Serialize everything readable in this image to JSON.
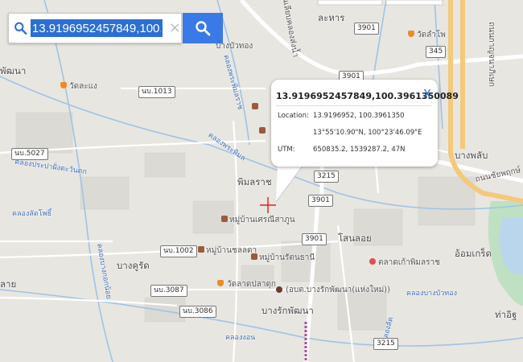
{
  "search": {
    "value": "13.9196952457849,100.3961350089",
    "clear_label": "×"
  },
  "popup": {
    "title": "13.9196952457849,100.3961350089",
    "close_label": "X",
    "location_label": "Location:",
    "location_value": "13.9196952, 100.3961350",
    "dms_value": "13°55'10.90\"N, 100°23'46.09\"E",
    "utm_label": "UTM:",
    "utm_value": "650835.2, 1539287.2, 47N"
  },
  "places": {
    "phimonrat": "พิมลราช",
    "sano_loi": "โสนลอย",
    "om_kret": "อ้อมเกร็ด",
    "bang_rak_phatthana": "บางรักพัฒนา",
    "bang_khu_rat": "บางคูรัด",
    "la_han": "ละหาร",
    "bang_bua_thong": "บางบัวทอง",
    "bang_phlap": "บางพลับ",
    "tha_it": "ท่าอิฐ",
    "bang_phai": "พัฒนา",
    "muang_edge": "ลาย",
    "khlong_lat_pho": "คลองลัดโพธิ์",
    "khlong_phraphim": "คลองพระพิมล",
    "khlong_bang_bua_thong": "คลองบางบัวทอง",
    "khlong_prapa": "คลองประปาฝั่งตะวันตก",
    "khlong_bangkok": "คลองบางกอกน้อย",
    "khlong_ngon": "คลองงอน",
    "khlong_phrong": "คลองพระพิมลราช",
    "thanon_liab": "ถนนเลียบคลองส่งน้ำ",
    "thanon_chaiyaphruek": "ถนนชัยพฤกษ์",
    "thanon_kanchana": "ถนนกาญจนาภิเษก",
    "khlong_ket": "คลองลัด",
    "khlong_right": "คลองบางบัวทอง",
    "wat_la_han": "วัดลำโพ",
    "wat_sano": "วัดละแง",
    "village_sri": "หมู่บ้านเศรณีสาภูน",
    "village_chon": "หมู่บ้านชลลดา",
    "village_rat": "หมู่บ้านรัตนธานี",
    "wat_pla": "วัดลาดปลาดุก",
    "market": "ตลาดเก้าพิมลราช",
    "school": "(อบต.บางรักพัฒนา(แห่งใหม่))",
    "thing_x": "บ้านบัวทอง"
  },
  "shields": {
    "s3901a": "3901",
    "s345": "345",
    "s3901b": "3901",
    "s3215a": "3215",
    "s3901c": "3901",
    "s3901d": "3901",
    "s3215b": "3215",
    "s1013": "นบ.1013",
    "s5027": "นบ.5027",
    "s1002": "นบ.1002",
    "s3087": "นบ.3087",
    "s3086": "นบ.3086"
  }
}
